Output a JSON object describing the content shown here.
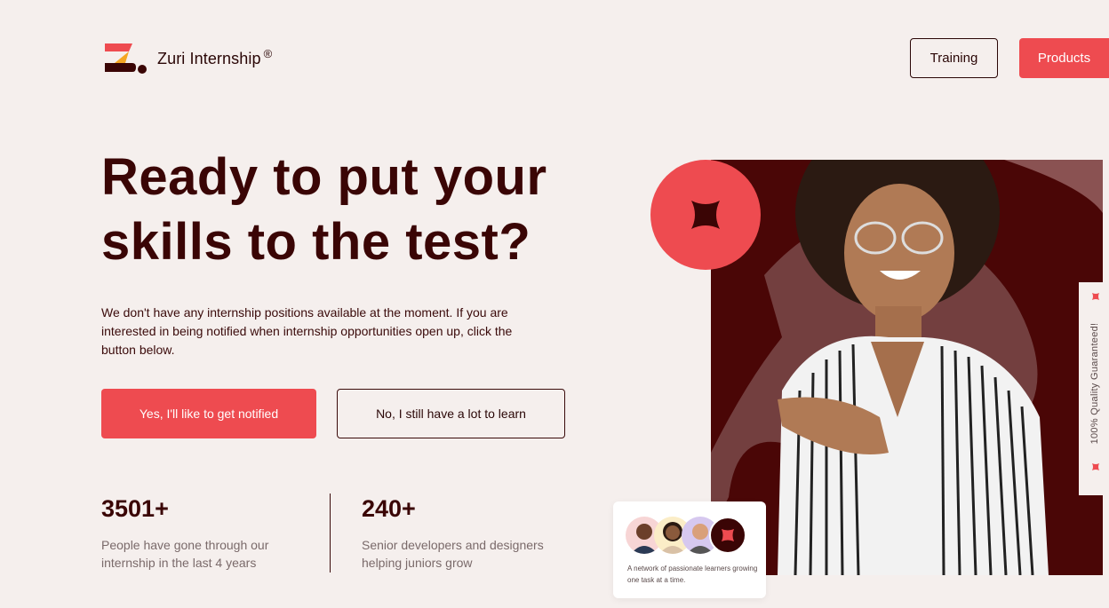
{
  "header": {
    "brand_name": "Zuri Internship",
    "brand_mark": "®",
    "nav": [
      {
        "label": "Training"
      },
      {
        "label": "Products"
      }
    ]
  },
  "hero": {
    "title": "Ready to put your skills to the test?",
    "description": "We don't have any internship positions available at the moment. If you are interested in being notified when internship opportunities open up, click the button below.",
    "cta_primary": "Yes, I'll like to get notified",
    "cta_secondary": "No, I still have a lot to learn"
  },
  "stats": [
    {
      "value": "3501+",
      "text": "People have gone through our internship in the last 4 years"
    },
    {
      "value": "240+",
      "text": "Senior developers and designers helping juniors grow"
    }
  ],
  "network_card": {
    "text": "A network of passionate learners growing one task at a time."
  },
  "side_tab": {
    "text": "100% Quality Guaranteed!"
  },
  "colors": {
    "accent": "#ee4b50",
    "dark": "#3a0505",
    "background": "#f5efed",
    "maroon": "#4a0606"
  }
}
